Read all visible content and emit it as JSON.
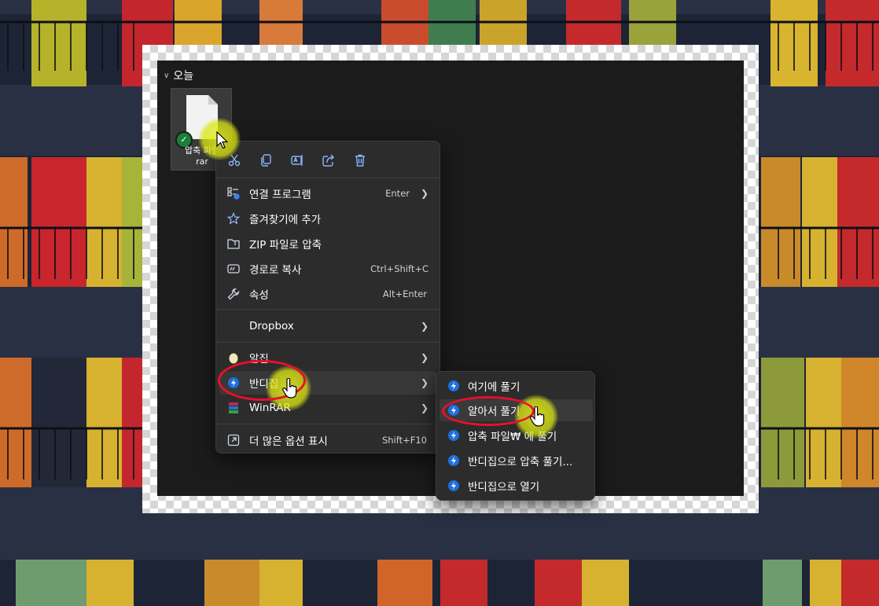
{
  "explorer": {
    "group_title": "오늘",
    "file": {
      "name_line1": "압축 파일",
      "name_line2": "rar"
    }
  },
  "context_menu": {
    "quick_actions": [
      {
        "icon": "cut-icon"
      },
      {
        "icon": "copy-icon"
      },
      {
        "icon": "rename-icon"
      },
      {
        "icon": "share-icon"
      },
      {
        "icon": "delete-icon"
      }
    ],
    "items": [
      {
        "label": "연결 프로그램",
        "shortcut": "Enter",
        "icon": "open-with-icon",
        "submenu": true
      },
      {
        "label": "즐겨찾기에 추가",
        "shortcut": "",
        "icon": "star-icon",
        "submenu": false
      },
      {
        "label": "ZIP 파일로 압축",
        "shortcut": "",
        "icon": "zip-folder-icon",
        "submenu": false
      },
      {
        "label": "경로로 복사",
        "shortcut": "Ctrl+Shift+C",
        "icon": "copy-path-icon",
        "submenu": false
      },
      {
        "label": "속성",
        "shortcut": "Alt+Enter",
        "icon": "wrench-icon",
        "submenu": false
      },
      {
        "label": "Dropbox",
        "shortcut": "",
        "icon": "",
        "submenu": true
      },
      {
        "label": "알집",
        "shortcut": "",
        "icon": "alzip-icon",
        "submenu": true
      },
      {
        "label": "반디집",
        "shortcut": "",
        "icon": "bandizip-icon",
        "submenu": true
      },
      {
        "label": "WinRAR",
        "shortcut": "",
        "icon": "winrar-icon",
        "submenu": true
      },
      {
        "label": "더 많은 옵션 표시",
        "shortcut": "Shift+F10",
        "icon": "more-options-icon",
        "submenu": false
      }
    ]
  },
  "submenu": {
    "items": [
      {
        "label": "여기에 풀기"
      },
      {
        "label": "알아서 풀기"
      },
      {
        "label": "압축 파일₩ 에 풀기"
      },
      {
        "label": "반디집으로 압축 풀기..."
      },
      {
        "label": "반디집으로 열기"
      }
    ]
  },
  "colors": {
    "menu_bg": "#2c2c2c",
    "explorer_bg": "#1b1b1b",
    "highlight_oval": "#e8102a",
    "cursor_halo": "#e6f01e",
    "bandizip_blue": "#1e6fe0"
  }
}
